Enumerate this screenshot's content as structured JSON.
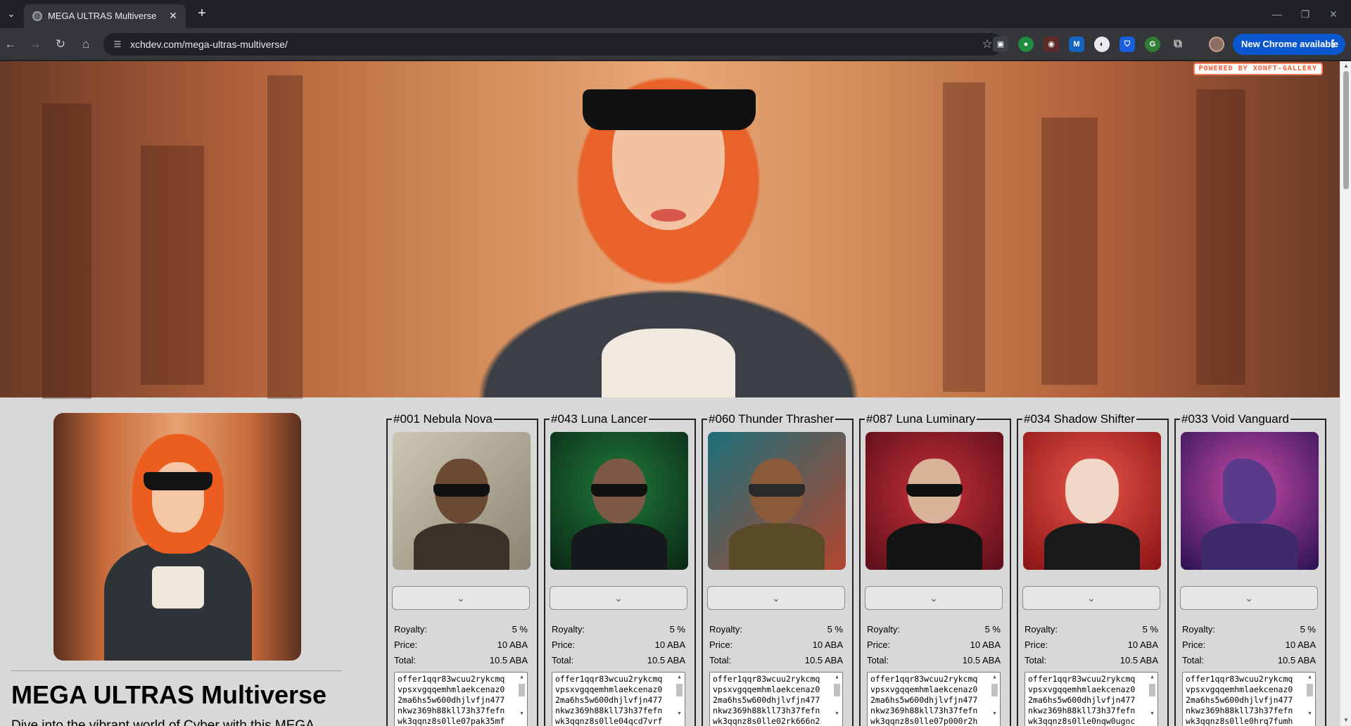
{
  "browser": {
    "tab_title": "MEGA ULTRAS Multiverse",
    "tab_close_glyph": "✕",
    "new_tab_glyph": "+",
    "url": "xchdev.com/mega-ultras-multiverse/",
    "update_button": "New Chrome available",
    "update_menu_glyph": "⋮",
    "nav": {
      "back": "←",
      "forward": "→",
      "reload": "↻",
      "home": "⌂",
      "star": "☆",
      "tab_search": "⌄"
    },
    "window_controls": {
      "minimize": "—",
      "maximize": "❐",
      "close": "✕"
    }
  },
  "page": {
    "powered_badge": "POWERED BY XONFT-GALLERY",
    "collection_title": "MEGA ULTRAS Multiverse",
    "collection_description": "Dive into the vibrant world of Cyber with this MEGA",
    "accent_color": "#ff5a36"
  },
  "cards": [
    {
      "title": "#001 Nebula Nova",
      "royalty_label": "Royalty:",
      "royalty": "5 %",
      "price_label": "Price:",
      "price": "10 ABA",
      "total_label": "Total:",
      "total": "10.5 ABA",
      "toggle_icon": "chevron-down-icon",
      "offer": "offer1qqr83wcuu2rykcmq\nvpsxvgqqemhmlaekcenaz0\n2ma6hs5w600dhjlvfjn477\nnkwz369h88kll73h37fefn\nwk3qqnz8s0lle07pak35mf"
    },
    {
      "title": "#043 Luna Lancer",
      "royalty_label": "Royalty:",
      "royalty": "5 %",
      "price_label": "Price:",
      "price": "10 ABA",
      "total_label": "Total:",
      "total": "10.5 ABA",
      "toggle_icon": "chevron-down-icon",
      "offer": "offer1qqr83wcuu2rykcmq\nvpsxvgqqemhmlaekcenaz0\n2ma6hs5w600dhjlvfjn477\nnkwz369h88kll73h37fefn\nwk3qqnz8s0lle04qcd7vrf"
    },
    {
      "title": "#060 Thunder Thrasher",
      "royalty_label": "Royalty:",
      "royalty": "5 %",
      "price_label": "Price:",
      "price": "10 ABA",
      "total_label": "Total:",
      "total": "10.5 ABA",
      "toggle_icon": "chevron-down-icon",
      "offer": "offer1qqr83wcuu2rykcmq\nvpsxvgqqemhmlaekcenaz0\n2ma6hs5w600dhjlvfjn477\nnkwz369h88kll73h37fefn\nwk3qqnz8s0lle02rk666n2"
    },
    {
      "title": "#087 Luna Luminary",
      "royalty_label": "Royalty:",
      "royalty": "5 %",
      "price_label": "Price:",
      "price": "10 ABA",
      "total_label": "Total:",
      "total": "10.5 ABA",
      "toggle_icon": "chevron-down-icon",
      "offer": "offer1qqr83wcuu2rykcmq\nvpsxvgqqemhmlaekcenaz0\n2ma6hs5w600dhjlvfjn477\nnkwz369h88kll73h37fefn\nwk3qqnz8s0lle07p000r2h"
    },
    {
      "title": "#034 Shadow Shifter",
      "royalty_label": "Royalty:",
      "royalty": "5 %",
      "price_label": "Price:",
      "price": "10 ABA",
      "total_label": "Total:",
      "total": "10.5 ABA",
      "toggle_icon": "chevron-down-icon",
      "offer": "offer1qqr83wcuu2rykcmq\nvpsxvgqqemhmlaekcenaz0\n2ma6hs5w600dhjlvfjn477\nnkwz369h88kll73h37fefn\nwk3qqnz8s0lle0nqw0ugnc"
    },
    {
      "title": "#033 Void Vanguard",
      "royalty_label": "Royalty:",
      "royalty": "5 %",
      "price_label": "Price:",
      "price": "10 ABA",
      "total_label": "Total:",
      "total": "10.5 ABA",
      "toggle_icon": "chevron-down-icon",
      "offer": "offer1qqr83wcuu2rykcmq\nvpsxvgqqemhmlaekcenaz0\n2ma6hs5w600dhjlvfjn477\nnkwz369h88kll73h37fefn\nwk3qqnz8s0lle0hrq7fumh"
    }
  ]
}
